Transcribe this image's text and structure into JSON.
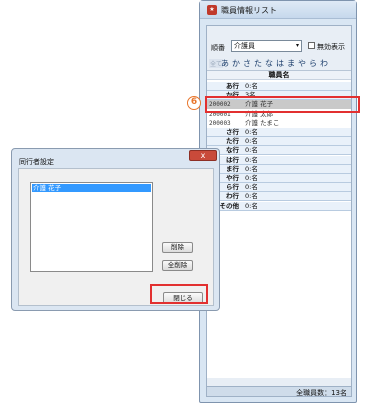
{
  "staff_window": {
    "title": "職員情報リスト",
    "app_icon": "app-icon",
    "order_label": "順番",
    "order_value": "介護員",
    "order_arrow": "▾",
    "hidden_label": "無効表示",
    "kana": [
      "全て",
      "あ",
      "か",
      "さ",
      "た",
      "な",
      "は",
      "ま",
      "や",
      "ら",
      "わ"
    ],
    "header": "職員名",
    "rows": [
      {
        "type": "group",
        "c1": "あ行",
        "c2": "0:名"
      },
      {
        "type": "group",
        "c1": "か行",
        "c2": "3名"
      },
      {
        "type": "staff",
        "c1": "200002",
        "c2": "介護 花子",
        "selected": true
      },
      {
        "type": "staff",
        "c1": "200001",
        "c2": "介護 太郎"
      },
      {
        "type": "staff",
        "c1": "200003",
        "c2": "介護 たまこ"
      },
      {
        "type": "group",
        "c1": "さ行",
        "c2": "0:名"
      },
      {
        "type": "group",
        "c1": "た行",
        "c2": "0:名"
      },
      {
        "type": "group",
        "c1": "な行",
        "c2": "0:名"
      },
      {
        "type": "group",
        "c1": "は行",
        "c2": "0:名"
      },
      {
        "type": "group",
        "c1": "ま行",
        "c2": "0:名"
      },
      {
        "type": "group",
        "c1": "や行",
        "c2": "0:名"
      },
      {
        "type": "group",
        "c1": "ら行",
        "c2": "0:名"
      },
      {
        "type": "group",
        "c1": "わ行",
        "c2": "0:名"
      },
      {
        "type": "group",
        "c1": "その他",
        "c2": "0:名"
      }
    ],
    "total": "全職員数：13名"
  },
  "annotation": {
    "step_number": "6",
    "color": "#e23030"
  },
  "dialog": {
    "title": "同行者設定",
    "close_glyph": "x",
    "list_item": "介護 花子",
    "delete_label": "削除",
    "delete_all_label": "全削除",
    "close_label": "閉じる"
  }
}
